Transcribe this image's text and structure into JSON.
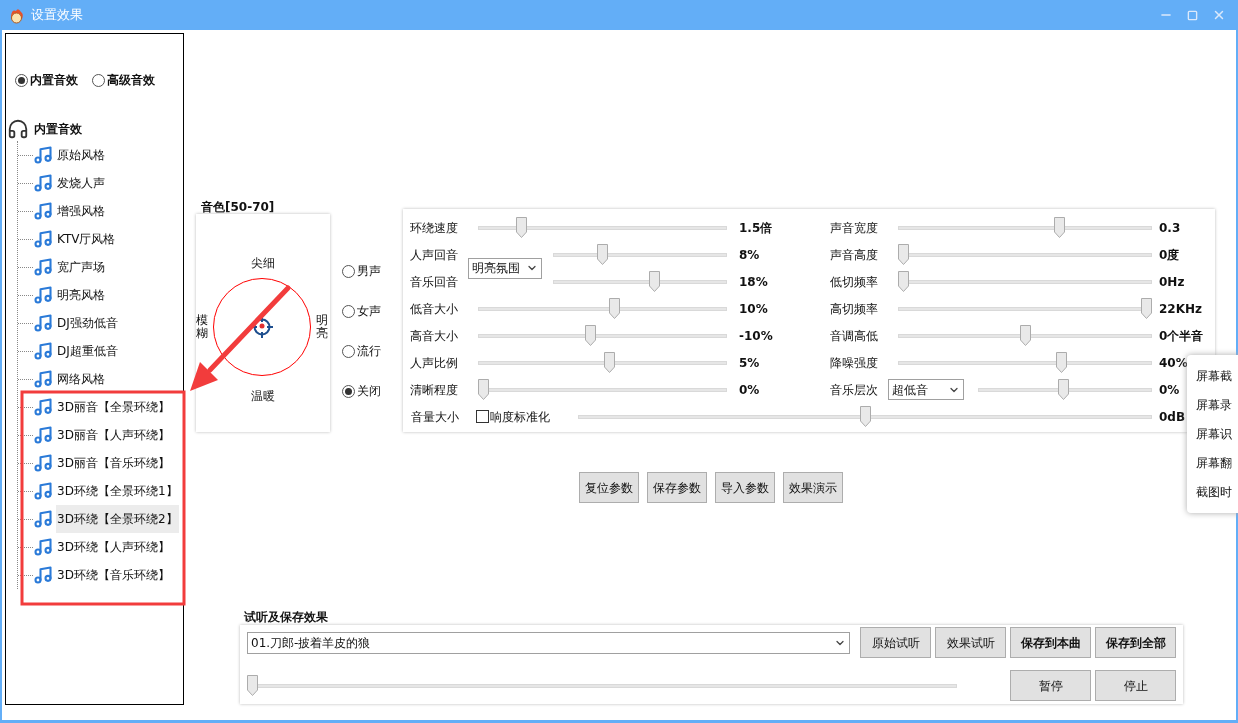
{
  "window": {
    "title": "设置效果"
  },
  "effect_mode": [
    {
      "label": "内置音效",
      "selected": true
    },
    {
      "label": "高级音效",
      "selected": false
    }
  ],
  "tree": {
    "label": "内置音效",
    "children": [
      {
        "label": "原始风格",
        "selected": false
      },
      {
        "label": "发烧人声",
        "selected": false
      },
      {
        "label": "增强风格",
        "selected": false
      },
      {
        "label": "KTV厅风格",
        "selected": false
      },
      {
        "label": "宽广声场",
        "selected": false
      },
      {
        "label": "明亮风格",
        "selected": false
      },
      {
        "label": "DJ强劲低音",
        "selected": false
      },
      {
        "label": "DJ超重低音",
        "selected": false
      },
      {
        "label": "网络风格",
        "selected": false
      },
      {
        "label": "3D丽音【全景环绕】",
        "selected": false
      },
      {
        "label": "3D丽音【人声环绕】",
        "selected": false
      },
      {
        "label": "3D丽音【音乐环绕】",
        "selected": false
      },
      {
        "label": "3D环绕【全景环绕1】",
        "selected": false
      },
      {
        "label": "3D环绕【全景环绕2】",
        "selected": true
      },
      {
        "label": "3D环绕【人声环绕】",
        "selected": false
      },
      {
        "label": "3D环绕【音乐环绕】",
        "selected": false
      }
    ]
  },
  "timbre": {
    "title": "音色[50-70]",
    "top": "尖细",
    "bottom": "温暖",
    "left": "模糊",
    "right": "明亮"
  },
  "voice_presets": [
    {
      "label": "男声",
      "selected": false
    },
    {
      "label": "女声",
      "selected": false
    },
    {
      "label": "流行",
      "selected": false
    },
    {
      "label": "关闭",
      "selected": true
    }
  ],
  "sliders_left": [
    {
      "kind": "slider",
      "label": "环绕速度",
      "level": 0.16,
      "reading": "1.5倍"
    },
    {
      "kind": "echo_group",
      "preset": "明亮氛围",
      "rows": [
        {
          "label": "人声回音",
          "level": 0.27,
          "reading": "8%"
        },
        {
          "label": "音乐回音",
          "level": 0.59,
          "reading": "18%"
        }
      ]
    },
    {
      "kind": "slider",
      "label": "低音大小",
      "level": 0.55,
      "reading": "10%"
    },
    {
      "kind": "slider",
      "label": "高音大小",
      "level": 0.45,
      "reading": "-10%"
    },
    {
      "kind": "slider",
      "label": "人声比例",
      "level": 0.53,
      "reading": "5%"
    },
    {
      "kind": "slider",
      "label": "清晰程度",
      "level": 0,
      "reading": "0%"
    }
  ],
  "sliders_right": [
    {
      "kind": "slider",
      "label": "声音宽度",
      "level": 0.64,
      "reading": "0.3"
    },
    {
      "kind": "slider",
      "label": "声音高度",
      "level": 0,
      "reading": "0度"
    },
    {
      "kind": "slider",
      "label": "低切频率",
      "level": 0,
      "reading": "0Hz"
    },
    {
      "kind": "slider",
      "label": "高切频率",
      "level": 1,
      "reading": "22KHz"
    },
    {
      "kind": "slider",
      "label": "音调高低",
      "level": 0.5,
      "reading": "0个半音"
    },
    {
      "kind": "slider",
      "label": "降噪强度",
      "level": 0.65,
      "reading": "40%"
    },
    {
      "kind": "slider_select",
      "label": "音乐层次",
      "preset": "超低音",
      "level": 0.49,
      "reading": "0%"
    }
  ],
  "volume": {
    "label": "音量大小",
    "checkbox": {
      "label": "响度标准化",
      "checked": false
    },
    "level": 0.5,
    "reading": "0dB"
  },
  "param_buttons": [
    "复位参数",
    "保存参数",
    "导入参数",
    "效果演示"
  ],
  "preview": {
    "title": "试听及保存效果",
    "track": "01.刀郎-披着羊皮的狼",
    "buttons": [
      {
        "label": "原始试听",
        "bold": false
      },
      {
        "label": "效果试听",
        "bold": false
      },
      {
        "label": "保存到本曲",
        "bold": true
      },
      {
        "label": "保存到全部",
        "bold": true
      }
    ],
    "level": 0,
    "playback_buttons": [
      "暂停",
      "停止"
    ]
  },
  "context_menu": [
    "屏幕截",
    "屏幕录",
    "屏幕识",
    "屏幕翻",
    "截图时"
  ]
}
